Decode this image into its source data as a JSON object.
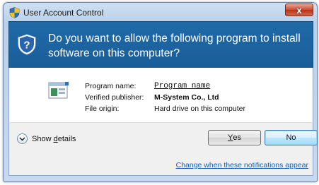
{
  "window": {
    "title": "User Account Control",
    "close_label": "x"
  },
  "header": {
    "question": "Do you want to allow the following program to install software on this computer?"
  },
  "program_info": {
    "name_label": "Program name:",
    "name_value": "Program name",
    "publisher_label": "Verified publisher:",
    "publisher_value": "M-System Co., Ltd",
    "origin_label": "File origin:",
    "origin_value": "Hard drive on this computer"
  },
  "footer": {
    "show_details_prefix": "Show ",
    "show_details_accesskey": "d",
    "show_details_suffix": "etails",
    "yes_accesskey": "Y",
    "yes_suffix": "es",
    "no_label": "No",
    "notifications_link": "Change when these notifications appear"
  },
  "colors": {
    "header_band": "#1f6aa8",
    "link": "#1a5fb4",
    "no_button_border": "#3c7fb1"
  },
  "icons": {
    "title_icon": "uac-shield-icon",
    "header_icon": "uac-shield-question-icon",
    "program_icon": "program-window-icon",
    "details_icon": "chevron-down-icon"
  }
}
